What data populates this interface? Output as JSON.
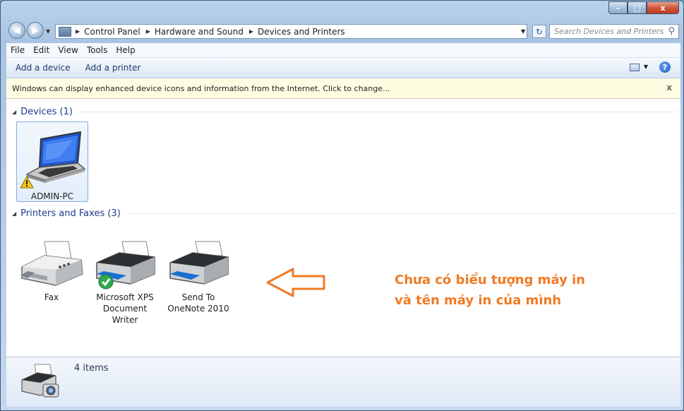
{
  "titlebar": {
    "min": "–",
    "max": "□",
    "close": "x"
  },
  "nav": {
    "back": "◀",
    "forward": "▶",
    "breadcrumb": [
      "Control Panel",
      "Hardware and Sound",
      "Devices and Printers"
    ],
    "search_placeholder": "Search Devices and Printers"
  },
  "menu": [
    "File",
    "Edit",
    "View",
    "Tools",
    "Help"
  ],
  "toolbar": {
    "add_device": "Add a device",
    "add_printer": "Add a printer",
    "help": "?"
  },
  "infobar": {
    "text": "Windows can display enhanced device icons and information from the Internet. Click to change...",
    "close": "x"
  },
  "groups": {
    "devices": {
      "label": "Devices (1)",
      "items": [
        {
          "name": "ADMIN-PC"
        }
      ]
    },
    "printers": {
      "label": "Printers and Faxes (3)",
      "items": [
        {
          "line1": "Fax",
          "line2": ""
        },
        {
          "line1": "Microsoft XPS",
          "line2": "Document Writer"
        },
        {
          "line1": "Send To",
          "line2": "OneNote 2010"
        }
      ]
    }
  },
  "annotation": {
    "line1": "Chưa có biểu tượng máy in",
    "line2": "và tên máy in của mình"
  },
  "details": {
    "count": "4 items"
  },
  "colors": {
    "accent": "#1e3a8c",
    "annotation": "#f07a24",
    "infobar": "#fffde1"
  }
}
